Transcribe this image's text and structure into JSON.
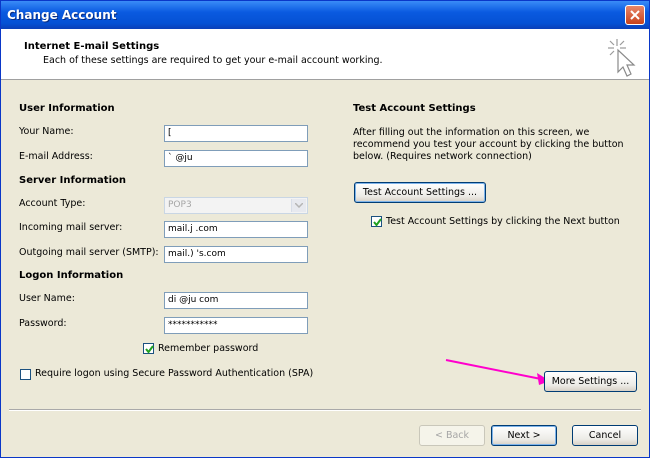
{
  "window": {
    "title": "Change Account"
  },
  "header": {
    "title": "Internet E-mail Settings",
    "subtitle": "Each of these settings are required to get your e-mail account working."
  },
  "user_info": {
    "section_title": "User Information",
    "name_label": "Your Name:",
    "name_value": "[",
    "email_label": "E-mail Address:",
    "email_value": "`     @ju"
  },
  "server_info": {
    "section_title": "Server Information",
    "account_type_label": "Account Type:",
    "account_type_value": "POP3",
    "incoming_label": "Incoming mail server:",
    "incoming_value": "mail.j                         .com",
    "outgoing_label": "Outgoing mail server (SMTP):",
    "outgoing_value": "mail.)                         's.com"
  },
  "logon_info": {
    "section_title": "Logon Information",
    "username_label": "User Name:",
    "username_value": "di      @ju                  com",
    "password_label": "Password:",
    "password_value": "***********",
    "remember_label": "Remember password",
    "remember_checked": true,
    "spa_label": "Require logon using Secure Password Authentication (SPA)",
    "spa_checked": false
  },
  "test_settings": {
    "section_title": "Test Account Settings",
    "description": [
      "After filling out the information on this screen, we",
      "recommend you test your account by clicking the button",
      "below. (Requires network connection)"
    ],
    "test_button": "Test Account Settings ...",
    "next_checkbox_label": "Test Account Settings by clicking the Next button",
    "next_checkbox_checked": true
  },
  "buttons": {
    "more_settings": "More Settings ...",
    "back": "< Back",
    "next": "Next >",
    "cancel": "Cancel"
  },
  "colors": {
    "title_bar": "#0a5ae0",
    "dialog_bg": "#ece9d8",
    "annotation_arrow": "#ff00cc"
  }
}
